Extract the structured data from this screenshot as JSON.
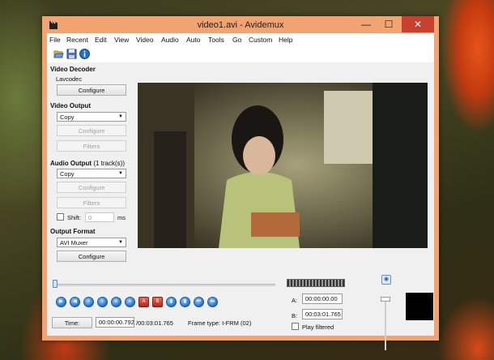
{
  "window": {
    "title": "video1.avi - Avidemux",
    "controls": {
      "minimize": "—",
      "maximize": "☐",
      "close": "✕"
    }
  },
  "menu": [
    "File",
    "Recent",
    "Edit",
    "View",
    "Video",
    "Audio",
    "Auto",
    "Tools",
    "Go",
    "Custom",
    "Help"
  ],
  "toolbar_icons": [
    "open-icon",
    "save-icon",
    "info-icon"
  ],
  "video_decoder": {
    "heading": "Video Decoder",
    "codec": "Lavcodec",
    "configure": "Configure"
  },
  "video_output": {
    "heading": "Video Output",
    "selected": "Copy",
    "configure": "Configure",
    "filters": "Filters"
  },
  "audio_output": {
    "heading": "Audio Output",
    "tracks": "(1 track(s))",
    "selected": "Copy",
    "configure": "Configure",
    "filters": "Filters",
    "shift_label": "Shift:",
    "shift_value": "0",
    "shift_unit": "ms"
  },
  "output_format": {
    "heading": "Output Format",
    "selected": "AVI Muxer",
    "configure": "Configure"
  },
  "time": {
    "button": "Time:",
    "current": "00:00:00.792",
    "total": "/00:03:01.765",
    "frame_type": "Frame type:  I-FRM (02)"
  },
  "selection": {
    "a_label": "A:",
    "a_value": "00:00:00.00",
    "b_label": "B:",
    "b_value": "00:03:01.765",
    "play_filtered": "Play filtered"
  },
  "colors": {
    "frame": "#f1a372",
    "close": "#c7402e",
    "button_blue": "#1f6fc8"
  }
}
